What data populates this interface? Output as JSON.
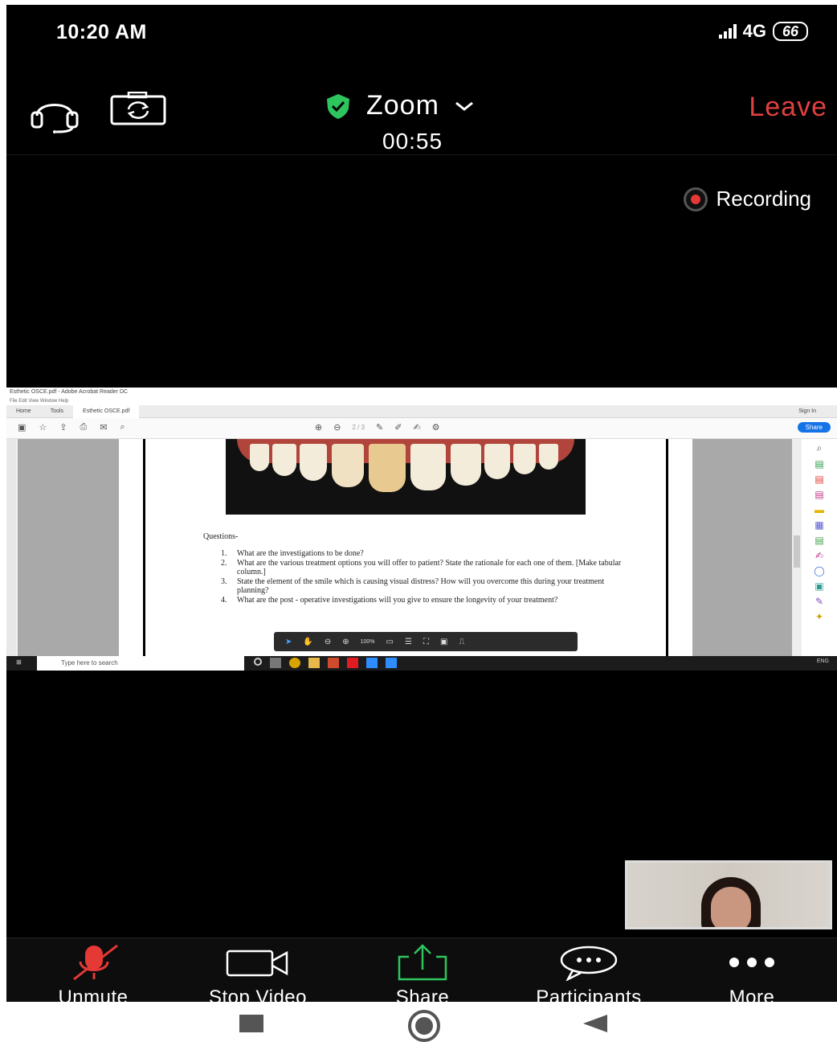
{
  "status_bar": {
    "time": "10:20 AM",
    "network": "4G",
    "battery": "66"
  },
  "meeting": {
    "app_title": "Zoom",
    "timer": "00:55",
    "leave_label": "Leave",
    "recording_label": "Recording",
    "secure_color": "#2ec55e",
    "leave_color": "#e0403e"
  },
  "shared_screen": {
    "window_title": "Esthetic OSCE.pdf - Adobe Acrobat Reader DC",
    "menu": "File  Edit  View  Window  Help",
    "tabs": [
      "Home",
      "Tools",
      "Esthetic OSCE.pdf"
    ],
    "sign_in": "Sign In",
    "page_indicator": "2 / 3",
    "share_label": "Share",
    "zoom_value": "100%",
    "questions_heading": "Questions-",
    "questions": [
      {
        "n": "1.",
        "text": "What are the investigations to be done?"
      },
      {
        "n": "2.",
        "text": "What are the various treatment options you will offer to patient? State the rationale for each one of them. [Make tabular column.]"
      },
      {
        "n": "3.",
        "text": "State the element of the smile which is causing visual distress? How will you overcome this during your treatment planning?"
      },
      {
        "n": "4.",
        "text": "What are the post - operative investigations will you give to ensure the longevity of your treatment?"
      }
    ],
    "taskbar_search": "Type here to search",
    "tray_text": "ENG"
  },
  "toolbar": {
    "unmute": "Unmute",
    "stop_video": "Stop Video",
    "share": "Share",
    "participants": "Participants",
    "more": "More",
    "mute_color": "#e53935",
    "share_color": "#2ec55e"
  },
  "icons": [
    "headset-icon",
    "camera-switch-icon",
    "shield-icon",
    "chevron-down-icon",
    "microphone-off-icon",
    "video-icon",
    "share-icon",
    "participants-icon",
    "more-icon"
  ]
}
